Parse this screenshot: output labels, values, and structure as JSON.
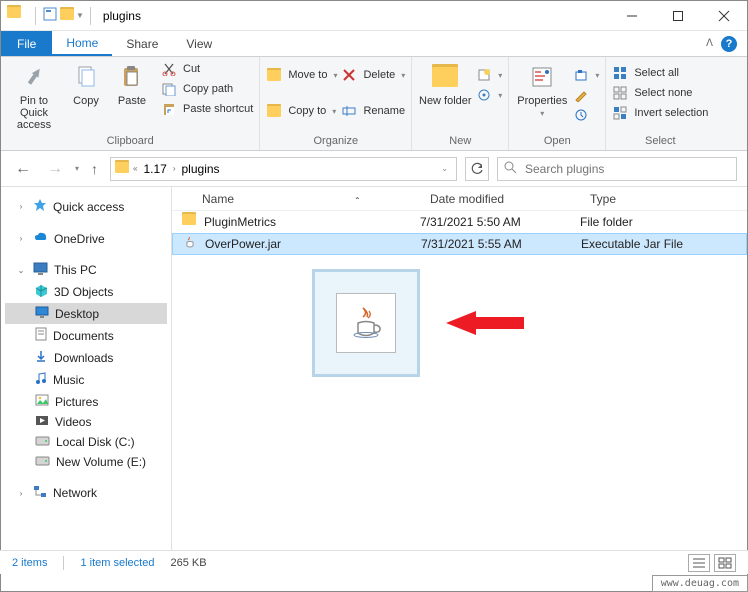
{
  "window": {
    "title": "plugins"
  },
  "tabs": {
    "file": "File",
    "home": "Home",
    "share": "Share",
    "view": "View"
  },
  "ribbon": {
    "clipboard": {
      "label": "Clipboard",
      "pin": "Pin to Quick access",
      "copy": "Copy",
      "paste": "Paste",
      "cut": "Cut",
      "copy_path": "Copy path",
      "paste_shortcut": "Paste shortcut"
    },
    "organize": {
      "label": "Organize",
      "move_to": "Move to",
      "copy_to": "Copy to",
      "delete": "Delete",
      "rename": "Rename"
    },
    "new": {
      "label": "New",
      "new_folder": "New folder"
    },
    "open": {
      "label": "Open",
      "properties": "Properties"
    },
    "select": {
      "label": "Select",
      "select_all": "Select all",
      "select_none": "Select none",
      "invert": "Invert selection"
    }
  },
  "breadcrumbs": {
    "parent": "1.17",
    "current": "plugins"
  },
  "search": {
    "placeholder": "Search plugins"
  },
  "nav": {
    "quick_access": "Quick access",
    "onedrive": "OneDrive",
    "this_pc": "This PC",
    "objects3d": "3D Objects",
    "desktop": "Desktop",
    "documents": "Documents",
    "downloads": "Downloads",
    "music": "Music",
    "pictures": "Pictures",
    "videos": "Videos",
    "local_c": "Local Disk (C:)",
    "new_volume": "New Volume (E:)",
    "network": "Network"
  },
  "columns": {
    "name": "Name",
    "date": "Date modified",
    "type": "Type"
  },
  "files": [
    {
      "name": "PluginMetrics",
      "date": "7/31/2021 5:50 AM",
      "type": "File folder",
      "kind": "folder"
    },
    {
      "name": "OverPower.jar",
      "date": "7/31/2021 5:55 AM",
      "type": "Executable Jar File",
      "kind": "jar"
    }
  ],
  "status": {
    "count": "2 items",
    "selection": "1 item selected",
    "size": "265 KB"
  },
  "watermark": "www.deuag.com"
}
